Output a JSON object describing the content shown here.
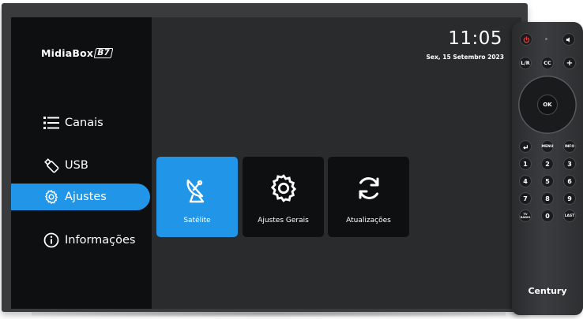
{
  "brand_logo": {
    "text": "MidiaBox",
    "badge": "B7"
  },
  "clock": {
    "time": "11:05",
    "date": "Sex, 15 Setembro 2023"
  },
  "sidebar": {
    "items": [
      {
        "label": "Canais",
        "icon": "list-icon",
        "active": false
      },
      {
        "label": "USB",
        "icon": "usb-drive-icon",
        "active": false
      },
      {
        "label": "Ajustes",
        "icon": "gear-icon",
        "active": true
      },
      {
        "label": "Informações",
        "icon": "info-icon",
        "active": false
      }
    ]
  },
  "tiles": [
    {
      "label": "Satélite",
      "icon": "satellite-dish-icon",
      "active": true
    },
    {
      "label": "Ajustes Gerais",
      "icon": "gear-icon",
      "active": false
    },
    {
      "label": "Atualizações",
      "icon": "refresh-icon",
      "active": false
    }
  ],
  "remote": {
    "brand": "Century",
    "buttons": {
      "power": "power-icon",
      "mute": "mute-icon",
      "lr": "L/R",
      "cc": "CC",
      "vol_up": "+",
      "ok": "OK",
      "back": "back-icon",
      "menu": "MENU",
      "info": "INFO",
      "tvradio": "TV RADIO",
      "last": "LAST",
      "digits": [
        "1",
        "2",
        "3",
        "4",
        "5",
        "6",
        "7",
        "8",
        "9",
        "0"
      ]
    }
  },
  "colors": {
    "accent": "#2196e8",
    "sidebar_bg": "#0e0f11",
    "screen_bg": "#2a2b2d",
    "power_red": "#e53935"
  }
}
